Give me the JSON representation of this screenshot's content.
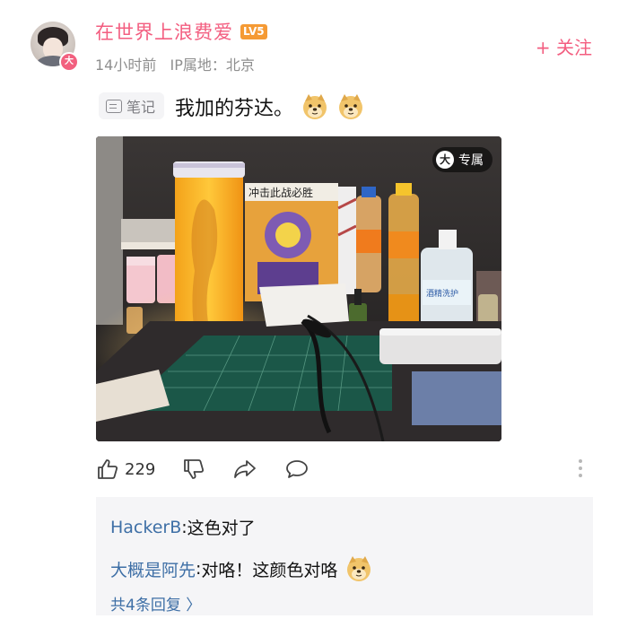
{
  "author": {
    "name": "在世界上浪费爱",
    "level": "LV5",
    "avatar_badge": "大",
    "time": "14小时前",
    "ip_location": "IP属地：北京"
  },
  "follow_label": "+ 关注",
  "post": {
    "tag": "笔记",
    "text": "我加的芬达。",
    "emoji": "doge-emoji"
  },
  "photo": {
    "badge_icon": "大",
    "badge_label": "专属"
  },
  "actions": {
    "like_count": "229"
  },
  "comments": [
    {
      "author": "HackerB",
      "separator": ": ",
      "text": "这色对了"
    },
    {
      "author": "大概是阿先",
      "separator": ": ",
      "text": "对咯！这颜色对咯"
    }
  ],
  "replies_link": "共4条回复 〉",
  "colors": {
    "accent_pink": "#f35e80",
    "link_blue": "#3e6fa6",
    "level_orange": "#f59a34"
  }
}
